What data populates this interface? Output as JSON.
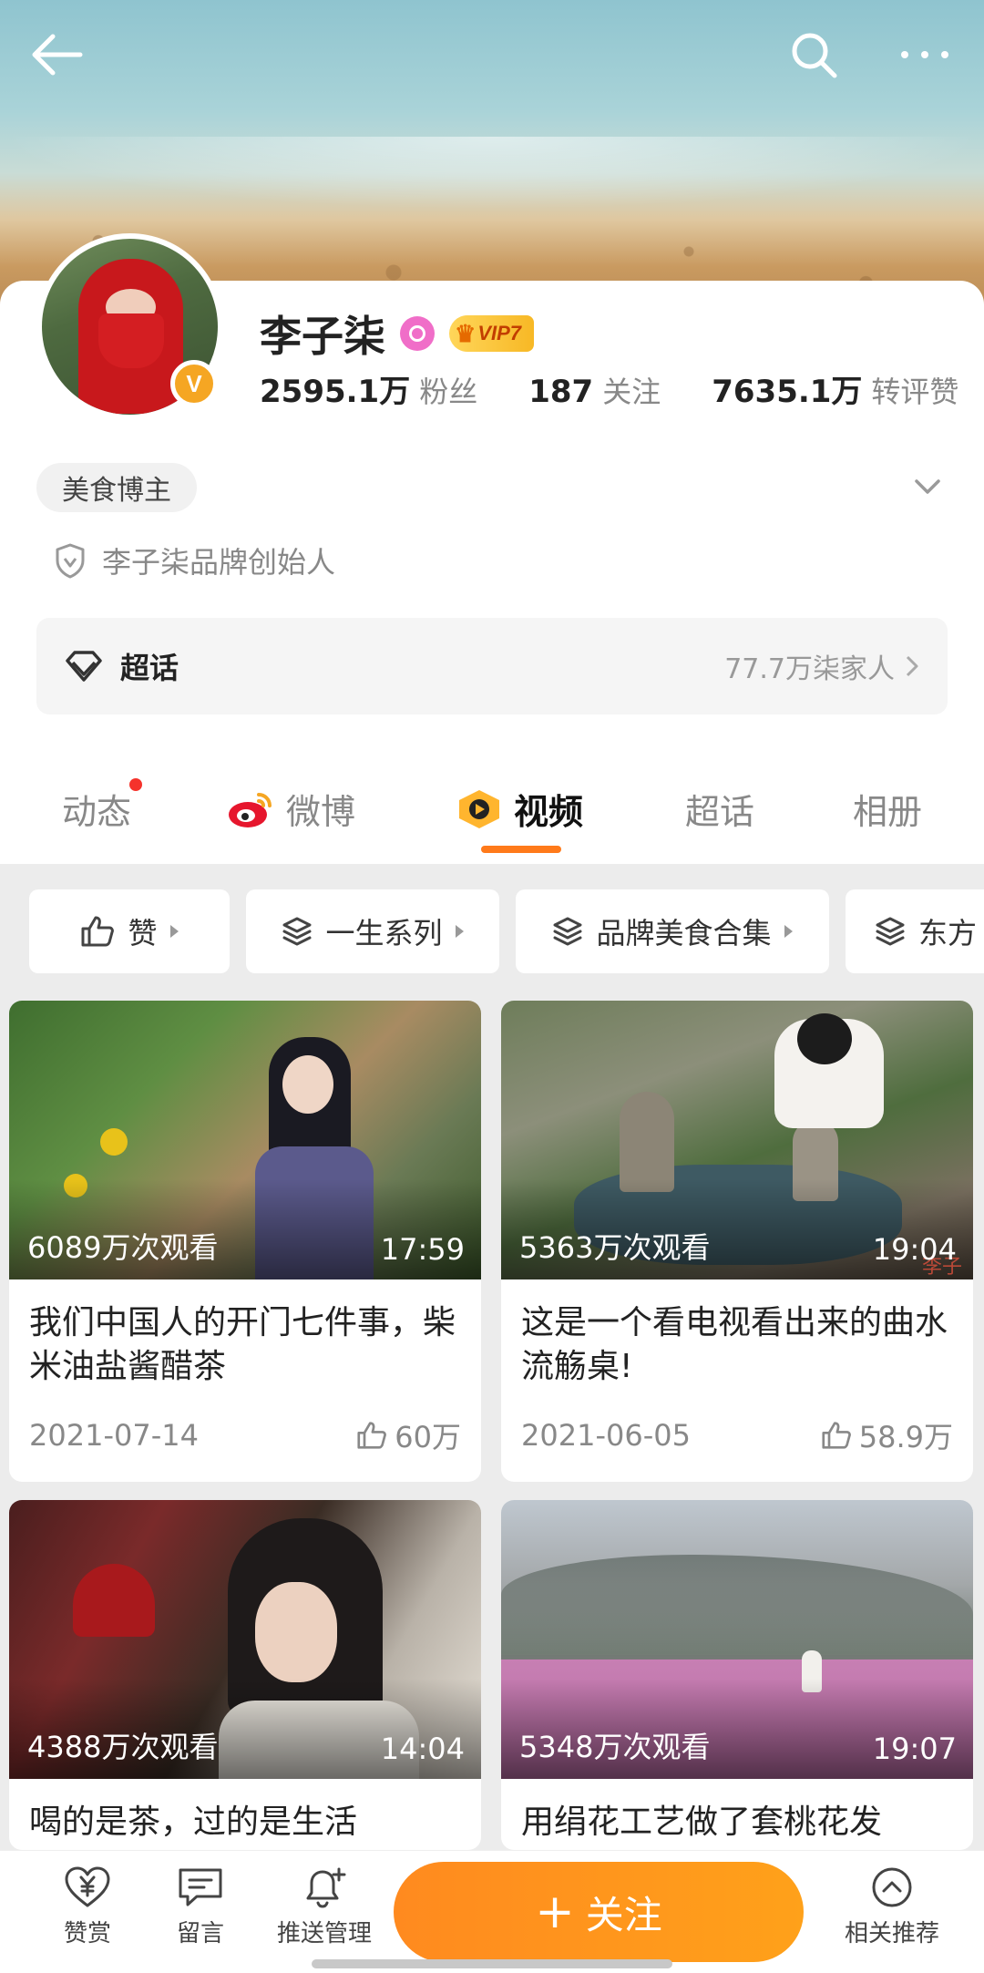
{
  "header": {
    "back_icon": "arrow-left-icon",
    "search_icon": "search-icon",
    "more_icon": "more-horizontal-icon"
  },
  "profile": {
    "name": "李子柒",
    "vip_label": "VIP7",
    "stats": [
      {
        "num": "2595.1万",
        "label": "粉丝"
      },
      {
        "num": "187",
        "label": "关注"
      },
      {
        "num": "7635.1万",
        "label": "转评赞"
      }
    ],
    "tag": "美食博主",
    "description": "李子柒品牌创始人",
    "supertopic": {
      "title": "超话",
      "count": "77.7万柒家人"
    }
  },
  "tabs": [
    {
      "label": "动态",
      "has_dot": true
    },
    {
      "label": "微博"
    },
    {
      "label": "视频",
      "active": true
    },
    {
      "label": "超话"
    },
    {
      "label": "相册"
    }
  ],
  "filters": [
    {
      "label": "赞"
    },
    {
      "label": "一生系列"
    },
    {
      "label": "品牌美食合集"
    },
    {
      "label": "东方"
    }
  ],
  "videos": [
    {
      "views": "6089万次观看",
      "duration": "17:59",
      "title": "我们中国人的开门七件事，柴米油盐酱醋茶",
      "date": "2021-07-14",
      "likes": "60万"
    },
    {
      "views": "5363万次观看",
      "duration": "19:04",
      "title": "这是一个看电视看出来的曲水流觞桌!",
      "date": "2021-06-05",
      "likes": "58.9万",
      "watermark": "李子"
    },
    {
      "views": "4388万次观看",
      "duration": "14:04",
      "title": "喝的是茶，过的是生活"
    },
    {
      "views": "5348万次观看",
      "duration": "19:07",
      "title": "用绢花工艺做了套桃花发"
    }
  ],
  "bottom_bar": {
    "items": [
      {
        "label": "赞赏"
      },
      {
        "label": "留言"
      },
      {
        "label": "推送管理"
      },
      {
        "label": "相关推荐"
      }
    ],
    "follow_label": "关注"
  },
  "colors": {
    "accent": "#ff8a1f",
    "tab_underline": "#ff7a1a",
    "verified_badge": "#f5a623"
  }
}
